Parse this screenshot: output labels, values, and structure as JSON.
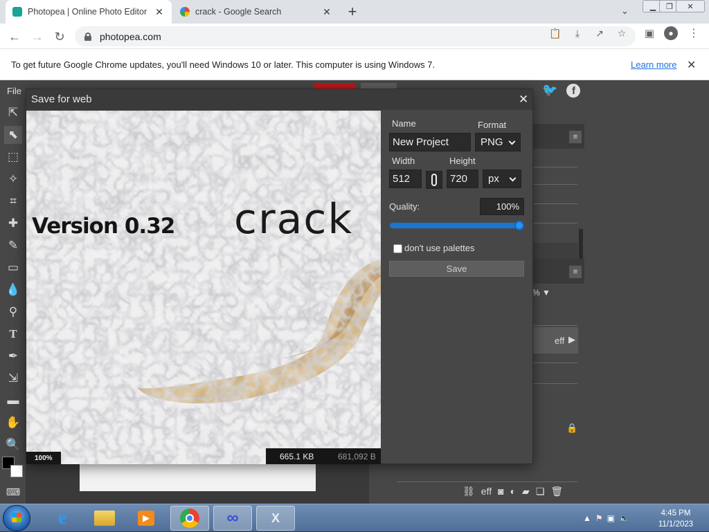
{
  "browser": {
    "tabs": [
      {
        "title": "Photopea | Online Photo Editor",
        "active": true
      },
      {
        "title": "crack - Google Search",
        "active": false
      }
    ],
    "new_tab_label": "+",
    "address": "photopea.com",
    "infobar": {
      "message": "To get future Google Chrome updates, you'll need Windows 10 or later. This computer is using Windows 7.",
      "learn_more": "Learn more"
    }
  },
  "photopea": {
    "menu_file": "File",
    "dialog": {
      "title": "Save for web",
      "name_label": "Name",
      "name_value": "New Project",
      "format_label": "Format",
      "format_value": "PNG",
      "width_label": "Width",
      "width_value": "512",
      "height_label": "Height",
      "height_value": "720",
      "unit_value": "px",
      "quality_label": "Quality:",
      "quality_value": "100%",
      "quality_fraction": 1.0,
      "palette_label": "don't use palettes",
      "palette_checked": false,
      "save_label": "Save",
      "preview_zoom": "100%",
      "file_size_kb": "665.1 KB",
      "file_size_bytes": "681,092 B",
      "preview_text_1": "Version 0.32",
      "preview_text_2": "crack"
    },
    "right_panel": {
      "opacity_fragment": "%",
      "effects_fragment": "eff",
      "layer_effects_label": "eff"
    }
  },
  "taskbar": {
    "time": "4:45 PM",
    "date": "11/1/2023"
  },
  "colors": {
    "accent": "#1976d2",
    "panel": "#474747",
    "chrome_bar": "#dee1e6"
  }
}
